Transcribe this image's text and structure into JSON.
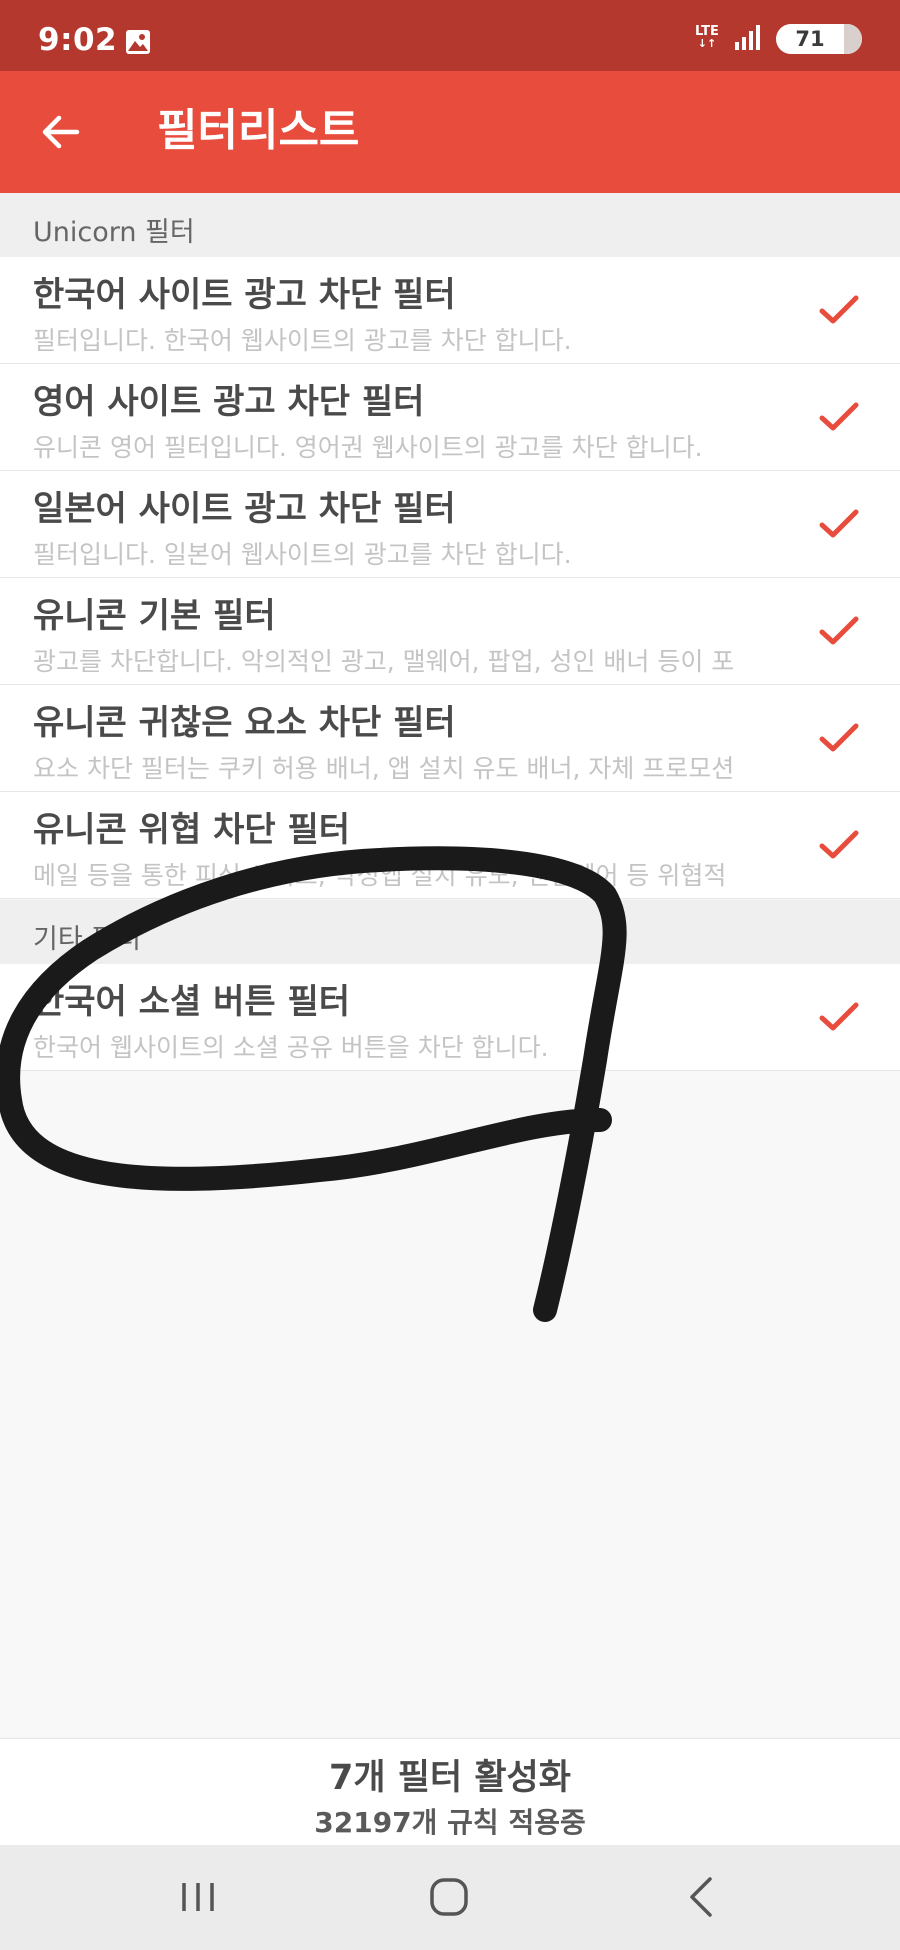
{
  "status_bar": {
    "time": "9:02",
    "network": "LTE",
    "battery": "71",
    "icons": [
      "gallery-icon",
      "lte-icon",
      "signal-icon",
      "battery-icon"
    ]
  },
  "app_bar": {
    "back_icon": "arrow-left-icon",
    "title": "필터리스트"
  },
  "sections": [
    {
      "header": "Unicorn 필터",
      "filters": [
        {
          "title": "한국어 사이트 광고 차단 필터",
          "description": "필터입니다. 한국어 웹사이트의 광고를 차단 합니다.",
          "enabled": true
        },
        {
          "title": "영어 사이트 광고 차단 필터",
          "description": "유니콘 영어 필터입니다. 영어권 웹사이트의 광고를 차단 합니다.",
          "enabled": true
        },
        {
          "title": "일본어 사이트 광고 차단 필터",
          "description": "필터입니다. 일본어 웹사이트의 광고를 차단 합니다.",
          "enabled": true
        },
        {
          "title": "유니콘 기본 필터",
          "description": "광고를 차단합니다. 악의적인 광고, 맬웨어, 팝업, 성인 배너 등이 포",
          "enabled": true
        },
        {
          "title": "유니콘 귀찮은 요소 차단 필터",
          "description": "요소 차단 필터는 쿠키 허용 배너, 앱 설치 유도 배너, 자체 프로모션",
          "enabled": true
        },
        {
          "title": "유니콘 위협 차단 필터",
          "description": "메일 등을 통한 피싱 사이트, 악성앱 설치 유도, 랜섬웨어 등 위협적",
          "enabled": true
        }
      ]
    },
    {
      "header": "기타 필터",
      "filters": [
        {
          "title": "한국어 소셜 버튼 필터",
          "description": "한국어 웹사이트의 소셜 공유 버튼을 차단 합니다.",
          "enabled": true
        }
      ]
    }
  ],
  "footer": {
    "active_count": "7개 필터 활성화",
    "rules_count": "32197개 규칙 적용중"
  },
  "nav_bar": {
    "icons": [
      "recent-apps-icon",
      "home-icon",
      "back-icon"
    ]
  },
  "colors": {
    "status_bar": "#b5382f",
    "app_bar": "#e84c3d",
    "accent_check": "#e84c3d",
    "scribble": "#1a1a1a"
  }
}
